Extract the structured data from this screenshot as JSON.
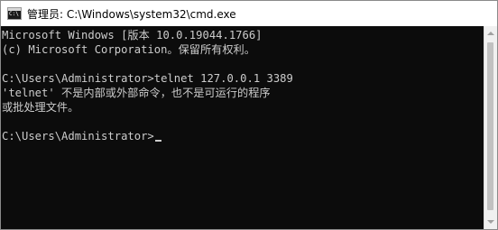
{
  "window": {
    "title": "管理员: C:\\Windows\\system32\\cmd.exe",
    "icon": "cmd-console-icon"
  },
  "console": {
    "lines": [
      "Microsoft Windows [版本 10.0.19044.1766]",
      "(c) Microsoft Corporation。保留所有权利。",
      "",
      "C:\\Users\\Administrator>telnet 127.0.0.1 3389",
      "'telnet' 不是内部或外部命令，也不是可运行的程序",
      "或批处理文件。",
      "",
      "C:\\Users\\Administrator>"
    ]
  },
  "colors": {
    "console_background": "#0c0c0c",
    "console_text": "#cccccc",
    "titlebar_background": "#ffffff"
  }
}
